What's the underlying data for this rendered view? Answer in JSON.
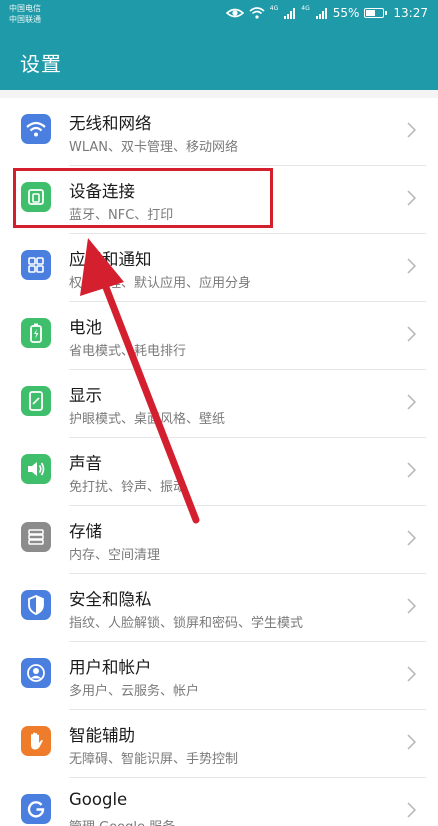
{
  "status_bar": {
    "carrier_1": "中国电信",
    "carrier_2": "中国联通",
    "sig_1": "4G",
    "sig_2": "4G",
    "battery": "55%",
    "battery_level": 0.55,
    "time": "13:27"
  },
  "header": {
    "title": "设置"
  },
  "colors": {
    "header": "#1e9aa8",
    "highlight": "#d4202e",
    "icon_blue": "#4a7fe0",
    "icon_green": "#3fbf6b",
    "icon_gray": "#8c8c8c",
    "icon_orange": "#ef7c2a"
  },
  "settings": [
    {
      "title": "无线和网络",
      "subtitle": "WLAN、双卡管理、移动网络",
      "icon": "wifi-icon"
    },
    {
      "title": "设备连接",
      "subtitle": "蓝牙、NFC、打印",
      "icon": "device-connection-icon"
    },
    {
      "title": "应用和通知",
      "subtitle": "权限管理、默认应用、应用分身",
      "icon": "apps-grid-icon"
    },
    {
      "title": "电池",
      "subtitle": "省电模式、耗电排行",
      "icon": "battery-icon"
    },
    {
      "title": "显示",
      "subtitle": "护眼模式、桌面风格、壁纸",
      "icon": "display-icon"
    },
    {
      "title": "声音",
      "subtitle": "免打扰、铃声、振动",
      "icon": "sound-icon"
    },
    {
      "title": "存储",
      "subtitle": "内存、空间清理",
      "icon": "storage-icon"
    },
    {
      "title": "安全和隐私",
      "subtitle": "指纹、人脸解锁、锁屏和密码、学生模式",
      "icon": "shield-icon"
    },
    {
      "title": "用户和帐户",
      "subtitle": "多用户、云服务、帐户",
      "icon": "user-account-icon"
    },
    {
      "title": "智能辅助",
      "subtitle": "无障碍、智能识屏、手势控制",
      "icon": "hand-icon"
    },
    {
      "title": "Google",
      "subtitle": "管理 Google 服务",
      "icon": "google-icon"
    }
  ]
}
